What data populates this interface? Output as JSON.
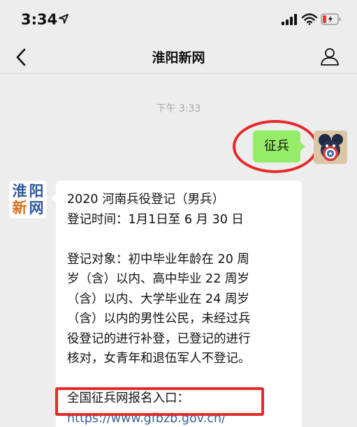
{
  "status_bar": {
    "time": "3:34",
    "icons": [
      "location-arrow-icon",
      "signal-icon",
      "wifi-icon",
      "battery-low-icon"
    ],
    "battery_color": "#e53935"
  },
  "nav": {
    "title": "淮阳新网",
    "back_icon": "chevron-left-icon",
    "profile_icon": "person-icon"
  },
  "chat": {
    "timestamp": "下午 3:33",
    "sent_message": "征兵",
    "sender_logo": [
      "淮",
      "阳",
      "新",
      "网"
    ],
    "received_lines": [
      "2020 河南兵役登记（男兵）",
      "登记时间：1月1日至 6 月 30 日",
      "",
      "登记对象：初中毕业年龄在 20 周",
      "岁（含）以内、高中毕业 22 周岁",
      "（含）以内、大学毕业在 24 周岁",
      "（含）以内的男性公民，未经过兵",
      "役登记的进行补登，已登记的进行",
      "核对，女青年和退伍军人不登记。",
      "",
      "全国征兵网报名入口："
    ],
    "link": "https://www.gfbzb.gov.cn/"
  },
  "colors": {
    "background": "#ededed",
    "sent_bubble": "#95ec69",
    "received_bubble": "#ffffff",
    "link": "#3a5f9a",
    "annotation_red": "#e52a2a"
  }
}
